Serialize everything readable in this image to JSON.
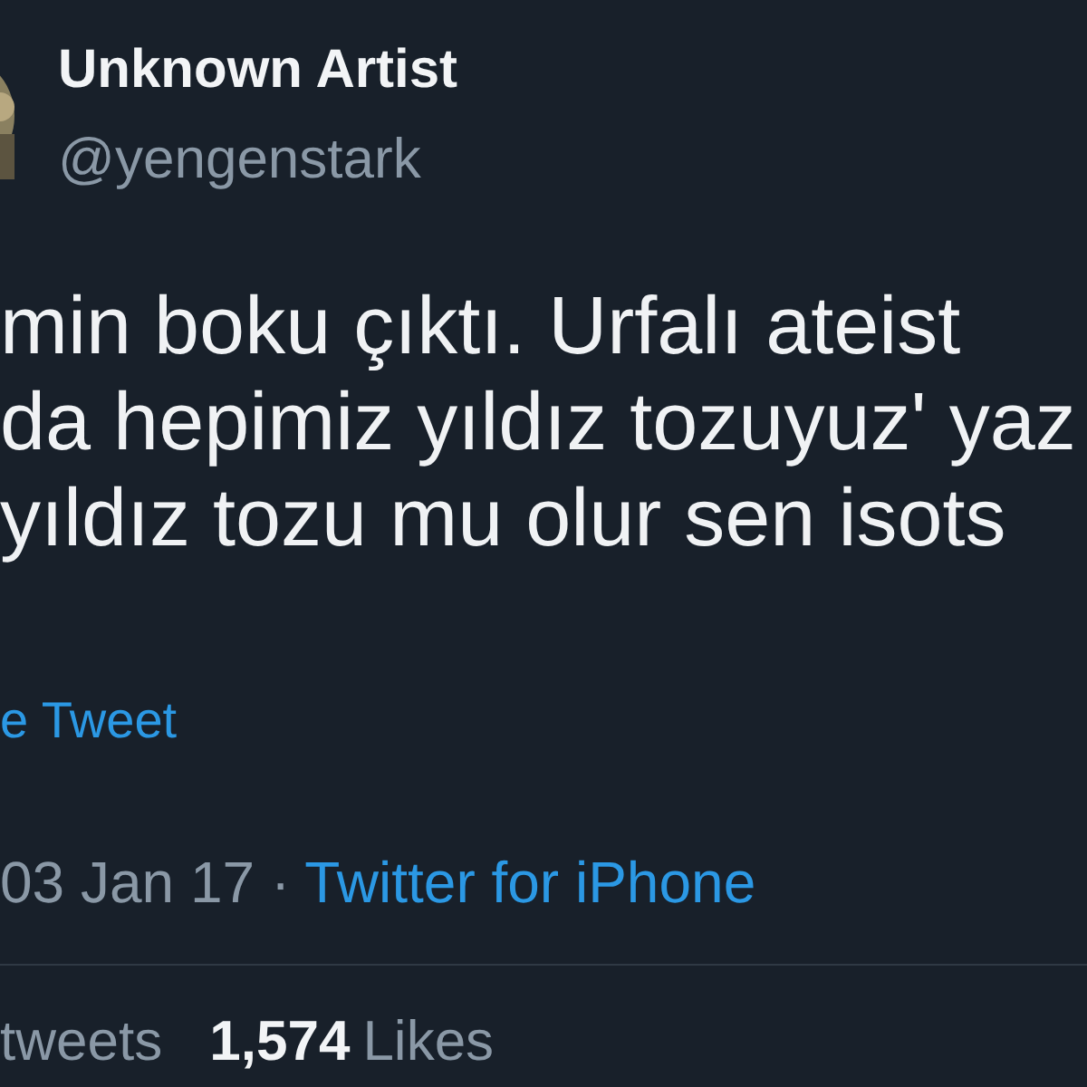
{
  "author": {
    "name": "Unknown Artist",
    "handle": "@yengenstark"
  },
  "tweet_lines": [
    "min boku çıktı. Urfalı ateist",
    "da hepimiz yıldız tozuyuz' yaz",
    "yıldız tozu mu olur sen isots"
  ],
  "translate_link": "e Tweet",
  "meta": {
    "date": "03 Jan 17 ·",
    "source": "Twitter for iPhone"
  },
  "stats": [
    {
      "label": "tweets"
    },
    {
      "count": "1,574",
      "label": "Likes"
    }
  ]
}
